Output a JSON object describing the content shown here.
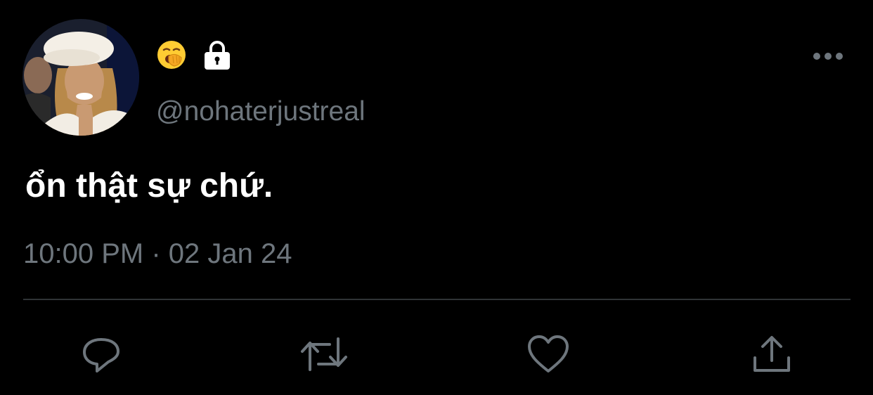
{
  "header": {
    "name_emoji_icon": "yawning-face-emoji",
    "protected_icon": "lock-icon",
    "handle": "@nohaterjustreal",
    "more_icon": "more-horizontal-icon"
  },
  "tweet": {
    "text": "ổn thật sự chứ.",
    "timestamp": "10:00 PM · 02 Jan 24"
  },
  "actions": [
    {
      "icon": "reply-icon"
    },
    {
      "icon": "retweet-icon"
    },
    {
      "icon": "like-icon"
    },
    {
      "icon": "share-icon"
    }
  ],
  "colors": {
    "background": "#000000",
    "primary_text": "#ffffff",
    "secondary_text": "#6e767d",
    "divider": "#2f3336",
    "icon": "#6e767d"
  }
}
